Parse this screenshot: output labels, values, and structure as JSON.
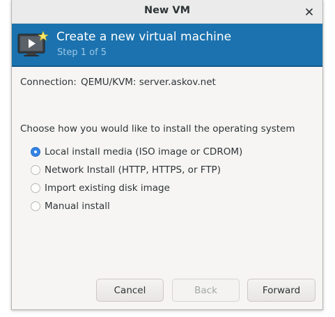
{
  "window": {
    "title": "New VM"
  },
  "header": {
    "title": "Create a new virtual machine",
    "step": "Step 1 of 5",
    "icon": "vm-monitor-icon"
  },
  "connection": {
    "label": "Connection:",
    "value": "QEMU/KVM: server.askov.net"
  },
  "install": {
    "prompt": "Choose how you would like to install the operating system",
    "options": [
      {
        "label": "Local install media (ISO image or CDROM)",
        "selected": true
      },
      {
        "label": "Network Install (HTTP, HTTPS, or FTP)",
        "selected": false
      },
      {
        "label": "Import existing disk image",
        "selected": false
      },
      {
        "label": "Manual install",
        "selected": false
      }
    ]
  },
  "buttons": {
    "cancel": "Cancel",
    "back": "Back",
    "forward": "Forward"
  },
  "colors": {
    "header_bg": "#1b72ae",
    "accent": "#3584e4"
  }
}
